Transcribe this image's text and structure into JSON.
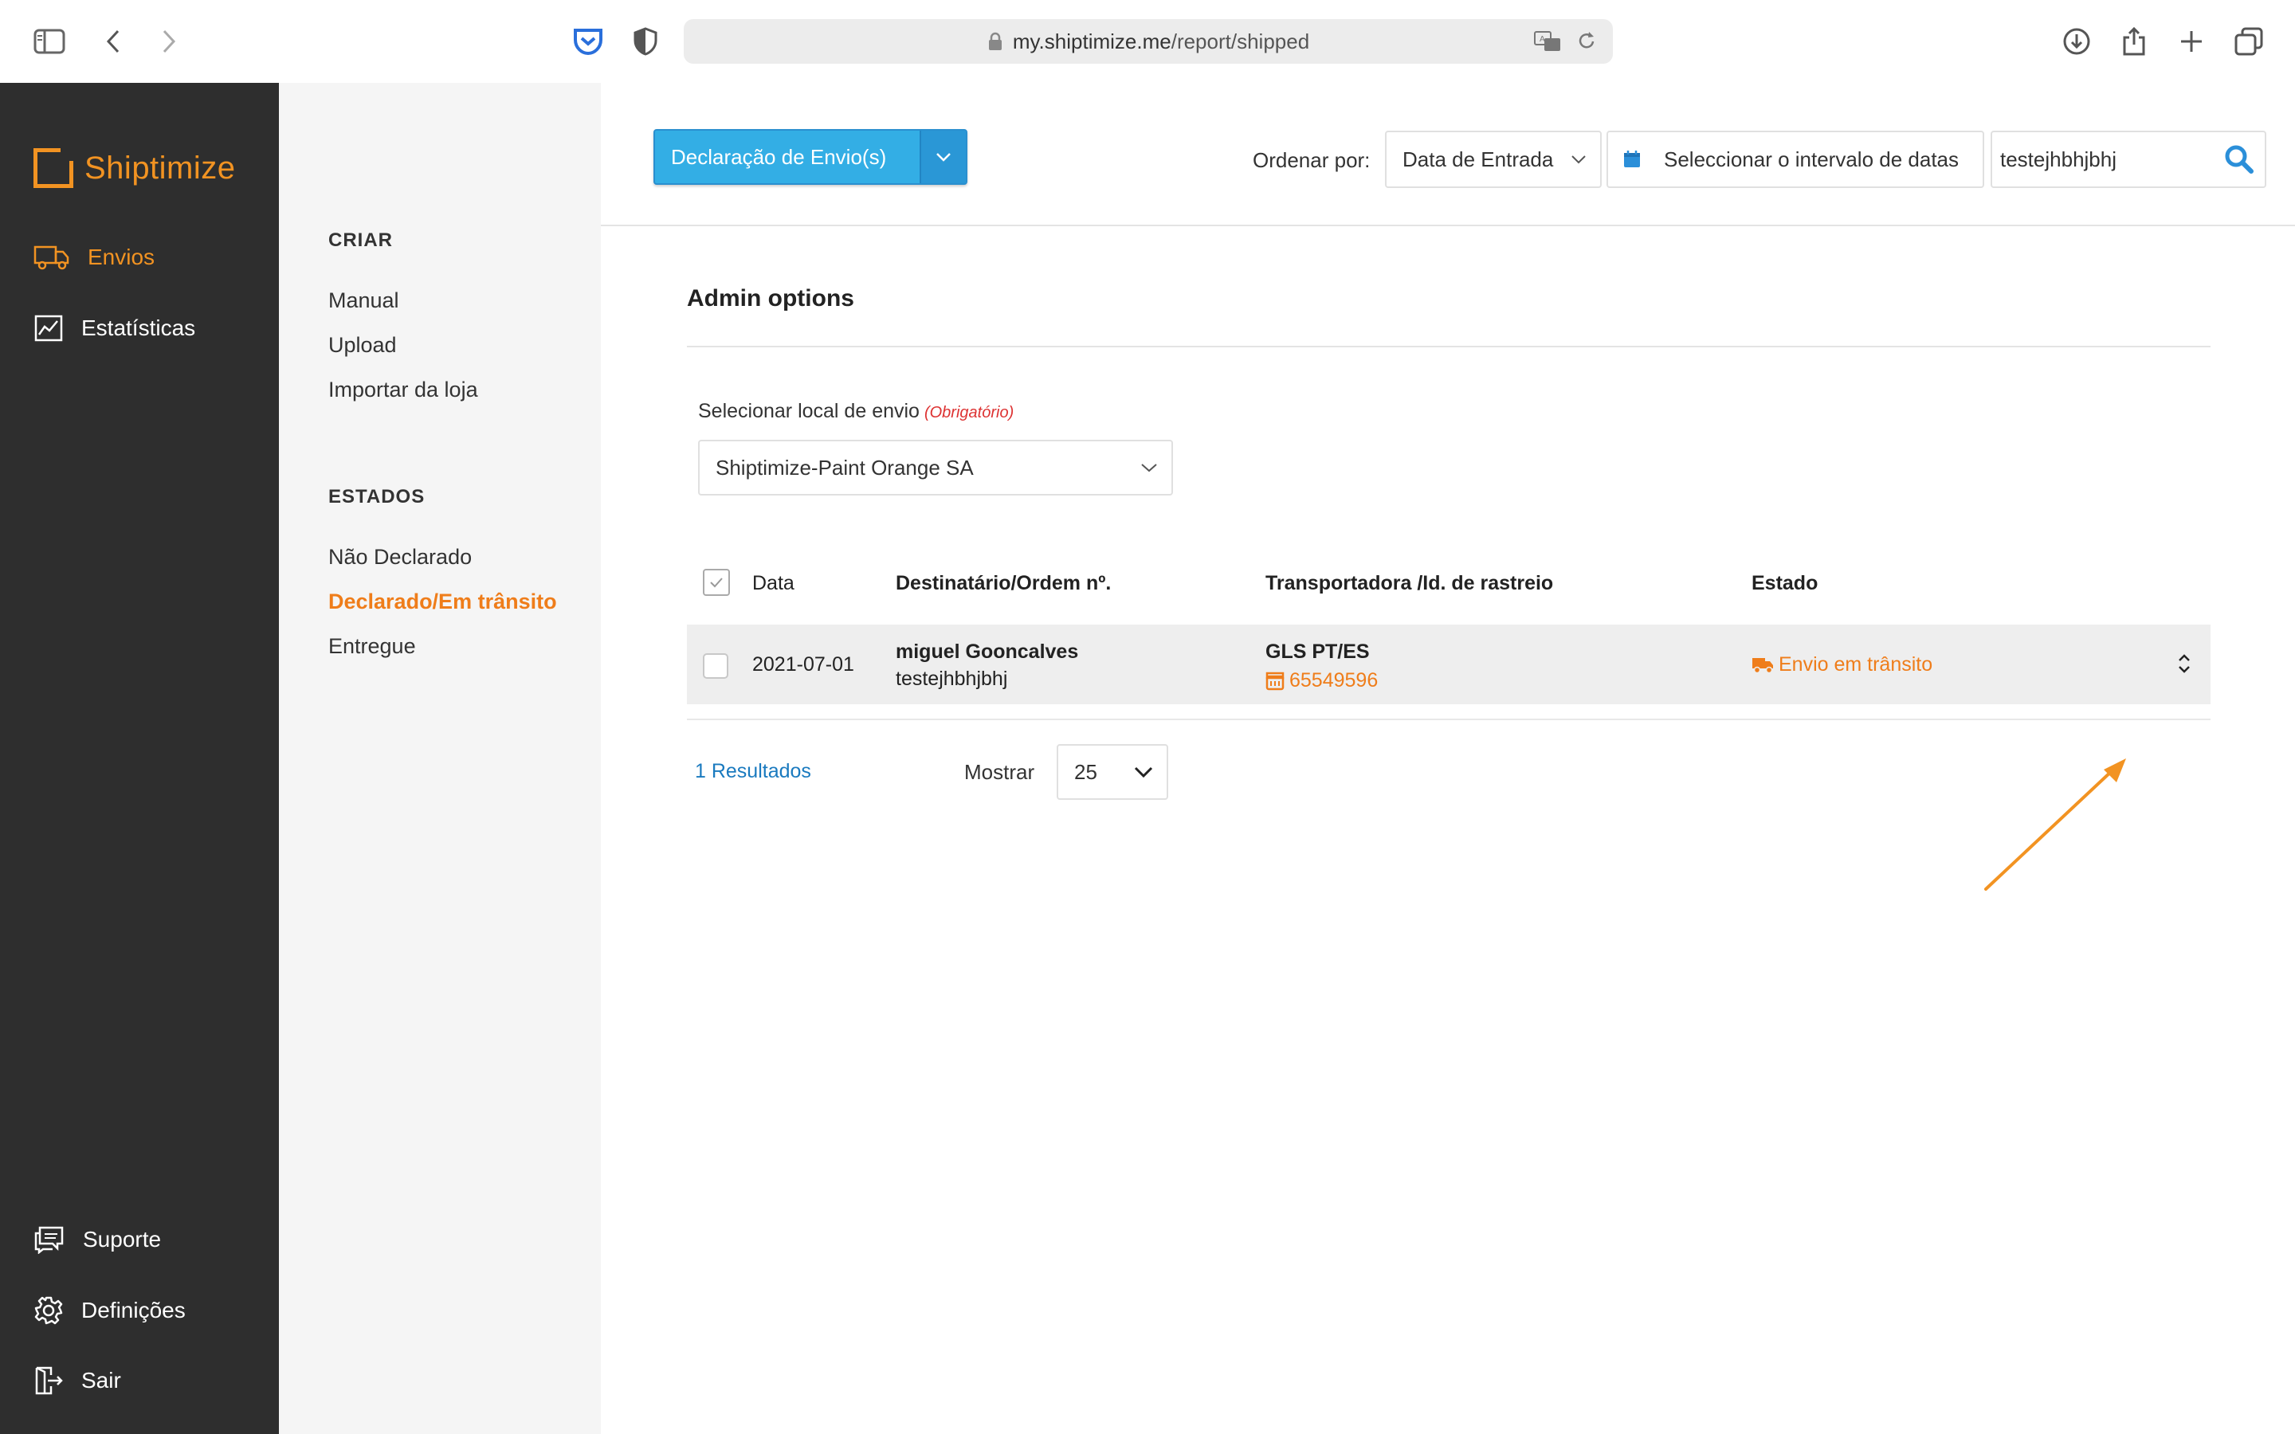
{
  "browser": {
    "url_host": "my.shiptimize.me",
    "url_path": "/report/shipped"
  },
  "sidebar": {
    "logo_text": "Shiptimize",
    "items": [
      {
        "label": "Envios",
        "icon": "truck-icon",
        "active": true
      },
      {
        "label": "Estatísticas",
        "icon": "chart-icon",
        "active": false
      }
    ],
    "bottom_items": [
      {
        "label": "Suporte",
        "icon": "chat-icon"
      },
      {
        "label": "Definições",
        "icon": "gear-icon"
      },
      {
        "label": "Sair",
        "icon": "logout-icon"
      }
    ]
  },
  "subnav": {
    "create_heading": "CRIAR",
    "create_links": [
      "Manual",
      "Upload",
      "Importar da loja"
    ],
    "states_heading": "ESTADOS",
    "state_links": [
      "Não Declarado",
      "Declarado/Em trânsito",
      "Entregue"
    ],
    "active_state": "Declarado/Em trânsito"
  },
  "toolbar": {
    "declare_button": "Declaração de Envio(s)",
    "sort_label": "Ordenar por:",
    "sort_value": "Data de Entrada",
    "date_range_label": "Seleccionar o intervalo de datas",
    "search_value": "testejhbhjbhj"
  },
  "admin": {
    "title": "Admin options",
    "location_label": "Selecionar local de envio",
    "location_required": "(Obrigatório)",
    "location_value": "Shiptimize-Paint Orange SA"
  },
  "table": {
    "headers": {
      "date": "Data",
      "recipient": "Destinatário/Ordem nº.",
      "carrier": "Transportadora /Id. de rastreio",
      "status": "Estado"
    },
    "rows": [
      {
        "date": "2021-07-01",
        "recipient": "miguel Gooncalves",
        "order": "testejhbhjbhj",
        "carrier": "GLS PT/ES",
        "tracking": "65549596",
        "status": "Envio em trânsito"
      }
    ]
  },
  "footer": {
    "results": "1 Resultados",
    "show_label": "Mostrar",
    "page_size": "25"
  },
  "colors": {
    "accent": "#f29322",
    "link_orange": "#ef7d1a",
    "primary_blue": "#33aee5",
    "sidebar_bg": "#2e2e2e"
  }
}
